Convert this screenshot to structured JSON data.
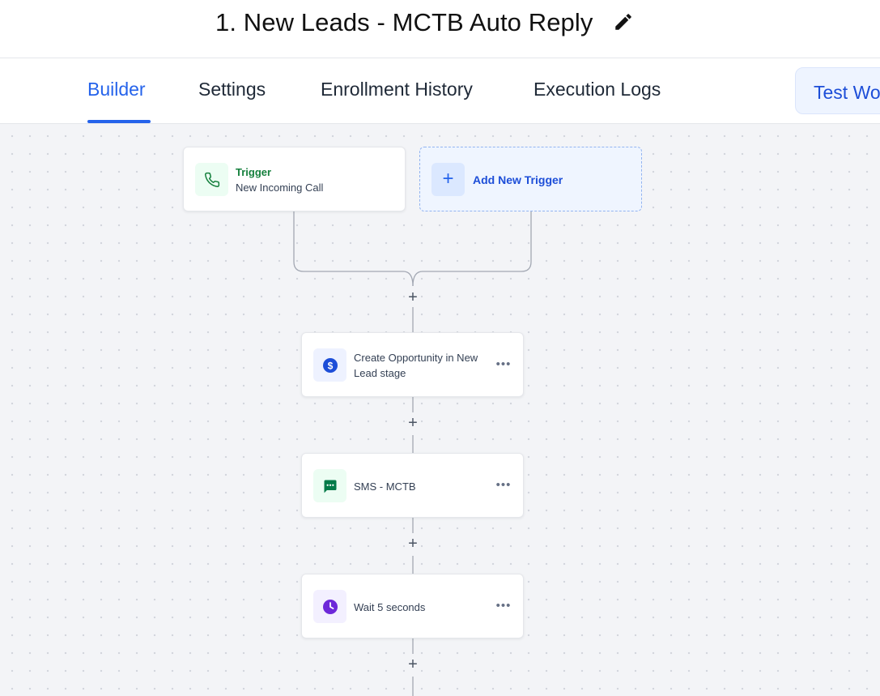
{
  "header": {
    "title": "1. New Leads - MCTB Auto Reply",
    "edit_icon": "pencil-icon"
  },
  "tabs": [
    {
      "label": "Builder",
      "active": true
    },
    {
      "label": "Settings",
      "active": false
    },
    {
      "label": "Enrollment History",
      "active": false
    },
    {
      "label": "Execution Logs",
      "active": false
    }
  ],
  "test_button": {
    "label": "Test Workflow"
  },
  "canvas": {
    "trigger": {
      "heading": "Trigger",
      "name": "New Incoming Call",
      "icon": "phone-icon"
    },
    "add_trigger": {
      "label": "Add New Trigger",
      "icon": "plus-icon"
    },
    "add_step_symbol": "+",
    "actions": [
      {
        "label_line1": "Create Opportunity in New",
        "label_line2": "Lead stage",
        "icon": "dollar-icon"
      },
      {
        "label_line1": "SMS - MCTB",
        "label_line2": "",
        "icon": "sms-icon"
      },
      {
        "label_line1": "Wait 5 seconds",
        "label_line2": "",
        "icon": "clock-icon"
      }
    ],
    "menu_symbol": "•••"
  },
  "colors": {
    "accent": "#2563eb",
    "trigger_green": "#15803d",
    "sms_green": "#027a48",
    "dollar_blue": "#1d4ed8",
    "wait_purple": "#6d28d9",
    "canvas_bg": "#f3f4f7"
  }
}
